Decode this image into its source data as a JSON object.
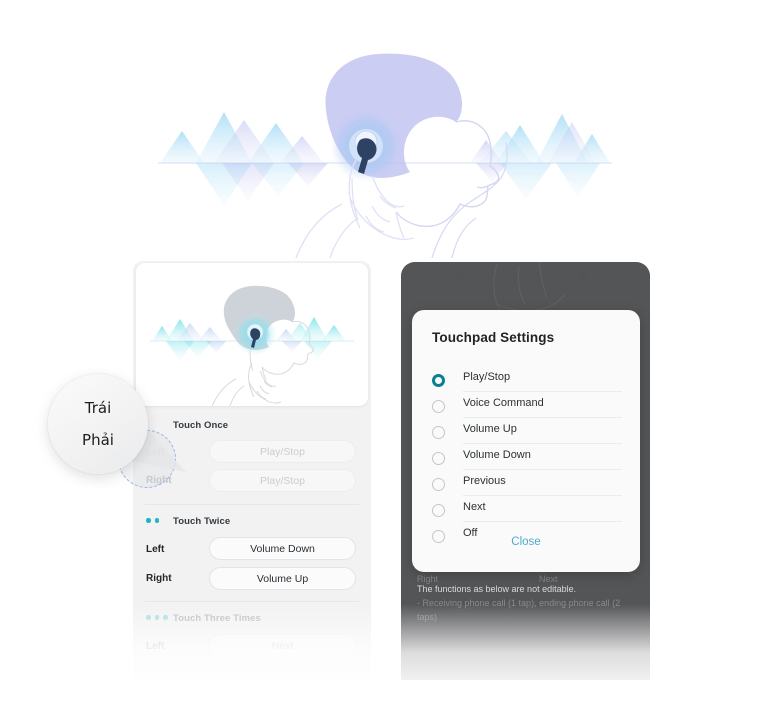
{
  "hero": {
    "alt_name": "man-wearing-earbud-soundwaves-illustration"
  },
  "left_panel": {
    "thumbnail_alt": "man-touching-earbud-illustration",
    "sections": [
      {
        "heading": "Touch Once",
        "dot_count": 1,
        "faded": false,
        "rows": [
          {
            "side": "Left",
            "value": "Play/Stop",
            "faded": true
          },
          {
            "side": "Right",
            "value": "Play/Stop",
            "faded": true
          }
        ]
      },
      {
        "heading": "Touch Twice",
        "dot_count": 2,
        "faded": false,
        "rows": [
          {
            "side": "Left",
            "value": "Volume Down",
            "faded": false
          },
          {
            "side": "Right",
            "value": "Volume Up",
            "faded": false
          }
        ]
      },
      {
        "heading": "Touch Three Times",
        "dot_count": 3,
        "faded": true,
        "rows": [
          {
            "side": "Left",
            "value": "Next",
            "faded": true
          }
        ]
      }
    ]
  },
  "magnifier": {
    "line1": "Trái",
    "line2": "Phải"
  },
  "dialog": {
    "title": "Touchpad Settings",
    "options": [
      {
        "label": "Play/Stop",
        "selected": true
      },
      {
        "label": "Voice Command",
        "selected": false
      },
      {
        "label": "Volume Up",
        "selected": false
      },
      {
        "label": "Volume Down",
        "selected": false
      },
      {
        "label": "Previous",
        "selected": false
      },
      {
        "label": "Next",
        "selected": false
      },
      {
        "label": "Off",
        "selected": false
      }
    ],
    "close_label": "Close"
  },
  "phone_background": {
    "ghost_rows": [
      {
        "side": "Right",
        "value": "Next"
      }
    ],
    "note_line1": "The functions as below are not editable.",
    "note_line2": "- Receiving phone call (1 tap), ending phone call (2 taps)"
  },
  "colors": {
    "accent_teal": "#21b3c6",
    "radio_selected": "#0b7f92",
    "close_link": "#4aacd4",
    "card_bg": "#f2f2f2",
    "phone_frame": "#5f6163",
    "text_primary": "#22262a",
    "text_dim": "#bfc3c7"
  }
}
